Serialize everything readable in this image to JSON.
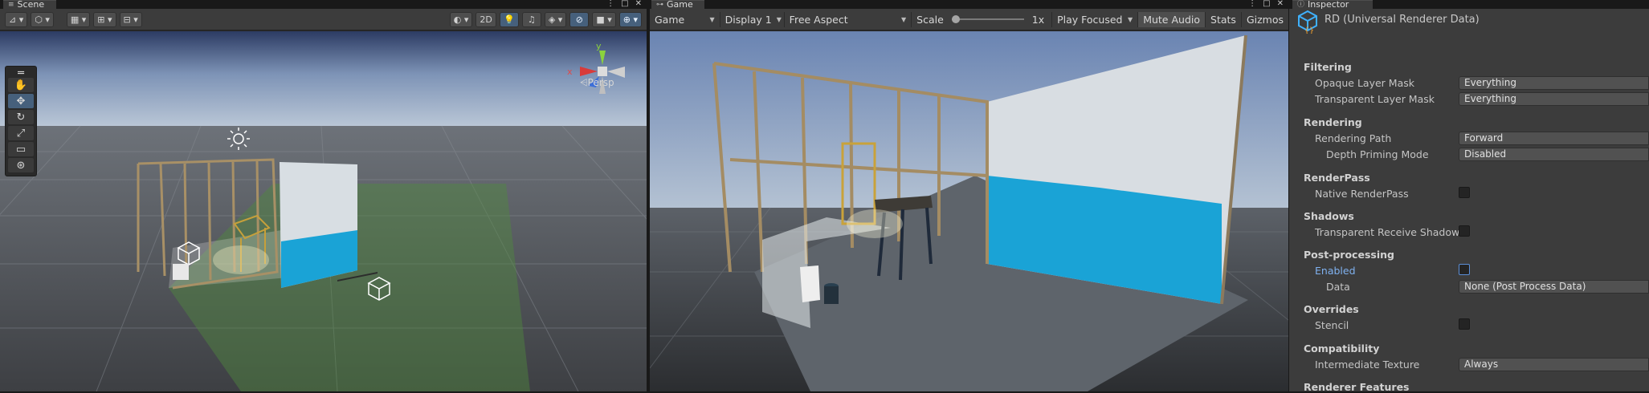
{
  "scene": {
    "tab_label": "Scene",
    "tab_buttons": [
      "⋮",
      "□",
      "✕"
    ],
    "toolbar": {
      "mode_2d": "2D",
      "persp_label": "Persp"
    },
    "axes": {
      "x": "x",
      "y": "y"
    }
  },
  "game": {
    "tab_label": "Game",
    "tab_buttons": [
      "⋮",
      "□",
      "✕"
    ],
    "toolbar": {
      "game_dropdown": "Game",
      "display_dropdown": "Display 1",
      "aspect_dropdown": "Free Aspect",
      "scale_label": "Scale",
      "scale_value": "1x",
      "play_focused": "Play Focused",
      "mute_audio": "Mute Audio",
      "stats": "Stats",
      "gizmos": "Gizmos"
    }
  },
  "inspector": {
    "tab_label": "Inspector",
    "title": "RD (Universal Renderer Data)",
    "sections": [
      {
        "title": "Filtering",
        "props": [
          {
            "label": "Opaque Layer Mask",
            "type": "dropdown",
            "value": "Everything"
          },
          {
            "label": "Transparent Layer Mask",
            "type": "dropdown",
            "value": "Everything"
          }
        ]
      },
      {
        "title": "Rendering",
        "props": [
          {
            "label": "Rendering Path",
            "type": "dropdown",
            "value": "Forward"
          },
          {
            "label": "Depth Priming Mode",
            "type": "dropdown",
            "value": "Disabled",
            "indent": true
          }
        ]
      },
      {
        "title": "RenderPass",
        "props": [
          {
            "label": "Native RenderPass",
            "type": "checkbox",
            "checked": false
          }
        ]
      },
      {
        "title": "Shadows",
        "props": [
          {
            "label": "Transparent Receive Shadows",
            "type": "checkbox",
            "checked": false
          }
        ]
      },
      {
        "title": "Post-processing",
        "props": [
          {
            "label": "Enabled",
            "type": "checkbox",
            "checked": false,
            "highlight": true
          },
          {
            "label": "Data",
            "type": "dropdown",
            "value": "None (Post Process Data)",
            "indent": true
          }
        ]
      },
      {
        "title": "Overrides",
        "props": [
          {
            "label": "Stencil",
            "type": "checkbox",
            "checked": false
          }
        ]
      },
      {
        "title": "Compatibility",
        "props": [
          {
            "label": "Intermediate Texture",
            "type": "dropdown",
            "value": "Always"
          }
        ]
      },
      {
        "title": "Renderer Features",
        "props": []
      }
    ]
  },
  "colors": {
    "water_blue": "#1aa3d6",
    "editor_bg": "#282828",
    "accent": "#46607c"
  }
}
